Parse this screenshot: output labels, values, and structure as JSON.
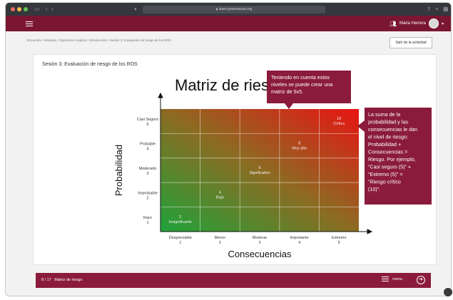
{
  "browser": {
    "url": "learn.ipsemanual.org"
  },
  "app": {
    "user_name": "Maria Herrera"
  },
  "breadcrumb": {
    "text": "Encuentro / Módulos / Opentrace Analysis / Introducción / Sesión 3: Evaluación de riesgo de los ROS"
  },
  "header": {
    "exit_label": "Salir de la actividad"
  },
  "section": {
    "title": "Sesión 3: Evaluación de riesgo de los ROS"
  },
  "matrix": {
    "title": "Matriz de riesgo",
    "y_axis_label": "Probabilidad",
    "x_axis_label": "Consecuencias",
    "y_ticks": [
      {
        "name": "Casi Seguro",
        "num": "5"
      },
      {
        "name": "Probable",
        "num": "4"
      },
      {
        "name": "Moderado",
        "num": "3"
      },
      {
        "name": "Improbable",
        "num": "2"
      },
      {
        "name": "Raro",
        "num": "1"
      }
    ],
    "x_ticks": [
      {
        "name": "Despreciable",
        "num": "1"
      },
      {
        "name": "Menor",
        "num": "2"
      },
      {
        "name": "Moderar",
        "num": "3"
      },
      {
        "name": "Importante",
        "num": "4"
      },
      {
        "name": "Extremo",
        "num": "5"
      }
    ],
    "cell_labels": [
      {
        "col": 1,
        "row": 1,
        "num": "2",
        "text": "Insignificante"
      },
      {
        "col": 2,
        "row": 2,
        "num": "4",
        "text": "Bajo"
      },
      {
        "col": 3,
        "row": 3,
        "num": "6",
        "text": "Significativo"
      },
      {
        "col": 4,
        "row": 4,
        "num": "8",
        "text": "Muy alto"
      },
      {
        "col": 5,
        "row": 5,
        "num": "10",
        "text": "Crítico"
      }
    ]
  },
  "callouts": {
    "top": "Teniendo en cuenta estos niveles se puede crear una matriz de 5x5.",
    "right": "La suma de la probabilidad y las consecuencias le dan el nivel de riesgo: Probabilidad + Consecuencias = Riesgo. Por ejemplo, “Casi seguro (5)” + “Extremo (5)” = “Riesgo crítico (10)”."
  },
  "bottom_bar": {
    "progress": "8 / 17",
    "title": "Matriz de riesgo",
    "menu_label": "menu"
  },
  "colors": {
    "brand": "#7b1632",
    "callout": "#8b1b3c",
    "green": "#1fa33a",
    "red": "#e81414"
  }
}
